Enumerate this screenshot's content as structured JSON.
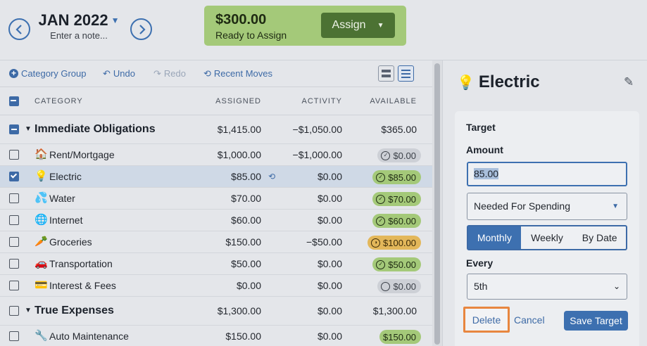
{
  "header": {
    "month": "JAN 2022",
    "note_placeholder": "Enter a note...",
    "ready_to_assign_amount": "$300.00",
    "ready_to_assign_label": "Ready to Assign",
    "assign_label": "Assign"
  },
  "toolbar": {
    "category_group": "Category Group",
    "undo": "Undo",
    "redo": "Redo",
    "recent_moves": "Recent Moves"
  },
  "columns": {
    "category": "CATEGORY",
    "assigned": "ASSIGNED",
    "activity": "ACTIVITY",
    "available": "AVAILABLE"
  },
  "rows": [
    {
      "type": "group",
      "name": "Immediate Obligations",
      "assigned": "$1,415.00",
      "activity": "−$1,050.00",
      "available": "$365.00"
    },
    {
      "type": "category",
      "emoji": "🏠",
      "name": "Rent/Mortgage",
      "assigned": "$1,000.00",
      "activity": "−$1,000.00",
      "available": "$0.00",
      "pill": "grey",
      "pill_icon": "✓"
    },
    {
      "type": "category",
      "emoji": "💡",
      "name": "Electric",
      "assigned": "$85.00",
      "activity": "$0.00",
      "available": "$85.00",
      "pill": "green",
      "pill_icon": "✓",
      "selected": true
    },
    {
      "type": "category",
      "emoji": "💦",
      "name": "Water",
      "assigned": "$70.00",
      "activity": "$0.00",
      "available": "$70.00",
      "pill": "green",
      "pill_icon": "✓"
    },
    {
      "type": "category",
      "emoji": "🌐",
      "name": "Internet",
      "assigned": "$60.00",
      "activity": "$0.00",
      "available": "$60.00",
      "pill": "green",
      "pill_icon": "✓"
    },
    {
      "type": "category",
      "emoji": "🥕",
      "name": "Groceries",
      "assigned": "$150.00",
      "activity": "−$50.00",
      "available": "$100.00",
      "pill": "gold",
      "pill_icon": "◑"
    },
    {
      "type": "category",
      "emoji": "🚗",
      "name": "Transportation",
      "assigned": "$50.00",
      "activity": "$0.00",
      "available": "$50.00",
      "pill": "green",
      "pill_icon": "✓"
    },
    {
      "type": "category",
      "emoji": "💳",
      "name": "Interest & Fees",
      "assigned": "$0.00",
      "activity": "$0.00",
      "available": "$0.00",
      "pill": "grey",
      "pill_icon": ""
    },
    {
      "type": "group",
      "name": "True Expenses",
      "assigned": "$1,300.00",
      "activity": "$0.00",
      "available": "$1,300.00"
    },
    {
      "type": "category",
      "emoji": "🔧",
      "name": "Auto Maintenance",
      "assigned": "$150.00",
      "activity": "$0.00",
      "available": "$150.00",
      "pill": "green",
      "pill_icon": ""
    }
  ],
  "inspector": {
    "emoji": "💡",
    "title": "Electric",
    "target_heading": "Target",
    "amount_label": "Amount",
    "amount_value": "85.00",
    "type_select": "Needed For Spending",
    "frequency": [
      "Monthly",
      "Weekly",
      "By Date"
    ],
    "frequency_selected": "Monthly",
    "every_label": "Every",
    "every_value": "5th",
    "delete_label": "Delete",
    "cancel_label": "Cancel",
    "save_label": "Save Target"
  },
  "colors": {
    "accent": "#3d70b0",
    "green": "#a4c979",
    "assign_button": "#4c7233",
    "gold": "#e3b75a",
    "highlight_outline": "#e8863f"
  }
}
